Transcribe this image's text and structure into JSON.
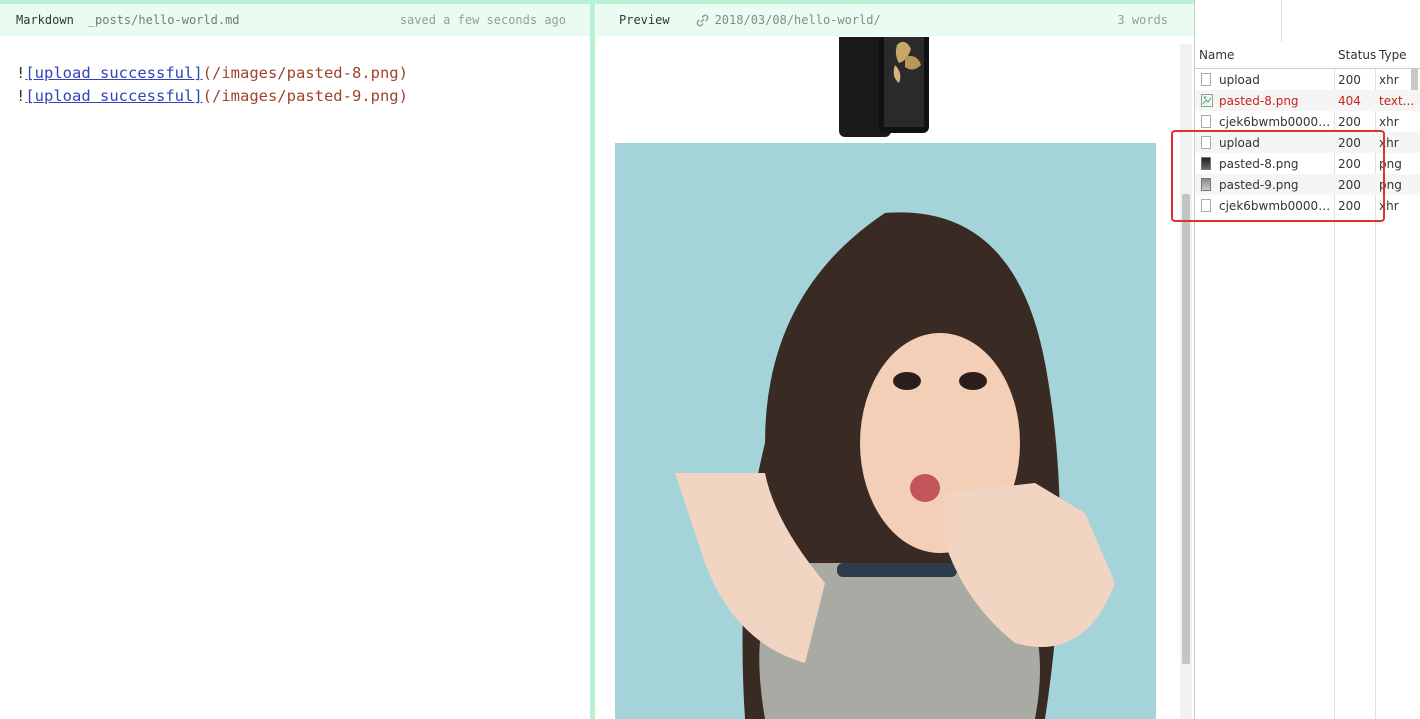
{
  "editor": {
    "title": "Markdown",
    "file_path": "_posts/hello-world.md",
    "save_status": "saved a few seconds ago",
    "lines": [
      {
        "prefix": "!",
        "link_text": "[upload successful]",
        "url": "(/images/pasted-8.png)"
      },
      {
        "prefix": "!",
        "link_text": "[upload successful]",
        "url": "(/images/pasted-9.png)"
      }
    ]
  },
  "preview": {
    "title": "Preview",
    "permalink": "2018/03/08/hello-world/",
    "word_count": "3 words",
    "images": [
      "phone-image",
      "portrait-photo"
    ]
  },
  "devtools": {
    "columns": {
      "name": "Name",
      "status": "Status",
      "type": "Type"
    },
    "requests": [
      {
        "name": "upload",
        "status": "200",
        "type": "xhr",
        "icon": "file-icon",
        "error": false
      },
      {
        "name": "pasted-8.png",
        "status": "404",
        "type": "text...",
        "icon": "broken-image-icon",
        "error": true
      },
      {
        "name": "cjek6bwmb0000tw...",
        "status": "200",
        "type": "xhr",
        "icon": "file-icon",
        "error": false
      },
      {
        "name": "upload",
        "status": "200",
        "type": "xhr",
        "icon": "file-icon",
        "error": false
      },
      {
        "name": "pasted-8.png",
        "status": "200",
        "type": "png",
        "icon": "image-icon",
        "error": false
      },
      {
        "name": "pasted-9.png",
        "status": "200",
        "type": "png",
        "icon": "image-icon",
        "error": false
      },
      {
        "name": "cjek6bwmb0000tw...",
        "status": "200",
        "type": "xhr",
        "icon": "file-icon",
        "error": false
      }
    ],
    "highlight_color": "#e0302f"
  },
  "colors": {
    "accent": "#b7f3d3",
    "header_bg": "#eafcf1",
    "link": "#3344bb",
    "url": "#a0442b",
    "error": "#c8221b"
  }
}
